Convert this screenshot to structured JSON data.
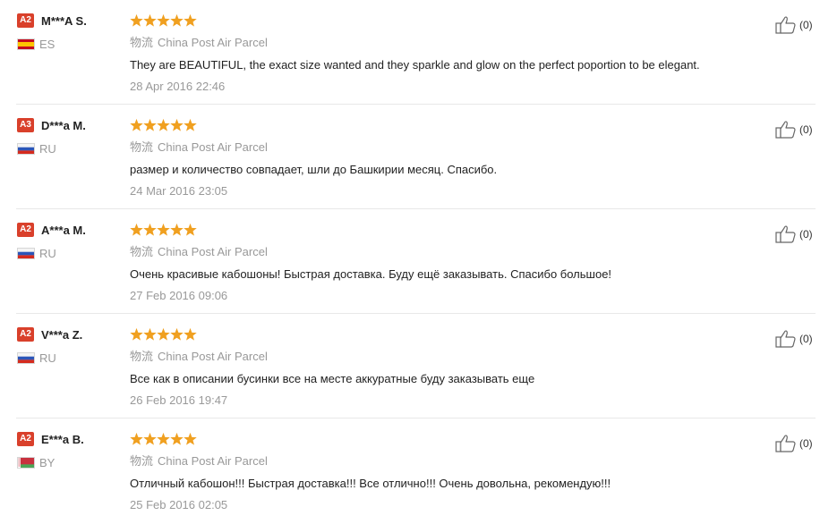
{
  "reviews": [
    {
      "level": "A2",
      "name": "M***A S.",
      "country": "ES",
      "flag": "spain-flag-icon",
      "stars": 5,
      "logistics_cn": "物流",
      "logistics": "China Post Air Parcel",
      "text": "They are BEAUTIFUL, the exact size wanted and they sparkle and glow on the perfect poportion to be elegant.",
      "date": "28 Apr 2016 22:46",
      "helpful": "(0)"
    },
    {
      "level": "A3",
      "name": "D***a M.",
      "country": "RU",
      "flag": "russia-flag-icon",
      "stars": 5,
      "logistics_cn": "物流",
      "logistics": "China Post Air Parcel",
      "text": "размер и количество совпадает, шли до Башкирии месяц. Спасибо.",
      "date": "24 Mar 2016 23:05",
      "helpful": "(0)"
    },
    {
      "level": "A2",
      "name": "A***a M.",
      "country": "RU",
      "flag": "russia-flag-icon",
      "stars": 5,
      "logistics_cn": "物流",
      "logistics": "China Post Air Parcel",
      "text": "Очень красивые кабошоны! Быстрая доставка. Буду ещё заказывать. Спасибо большое!",
      "date": "27 Feb 2016 09:06",
      "helpful": "(0)"
    },
    {
      "level": "A2",
      "name": "V***a Z.",
      "country": "RU",
      "flag": "russia-flag-icon",
      "stars": 5,
      "logistics_cn": "物流",
      "logistics": "China Post Air Parcel",
      "text": "Все как в описании бусинки все на месте аккуратные буду заказывать еще",
      "date": "26 Feb 2016 19:47",
      "helpful": "(0)"
    },
    {
      "level": "A2",
      "name": "E***a B.",
      "country": "BY",
      "flag": "belarus-flag-icon",
      "stars": 5,
      "logistics_cn": "物流",
      "logistics": "China Post Air Parcel",
      "text": "Отличный кабошон!!! Быстрая доставка!!! Все отлично!!! Очень довольна, рекомендую!!!",
      "date": "25 Feb 2016 02:05",
      "helpful": "(0)"
    }
  ],
  "colors": {
    "star": "#f0a020",
    "level_badge": "#d9402b",
    "muted_text": "#999999",
    "divider": "#e8e8e8"
  }
}
